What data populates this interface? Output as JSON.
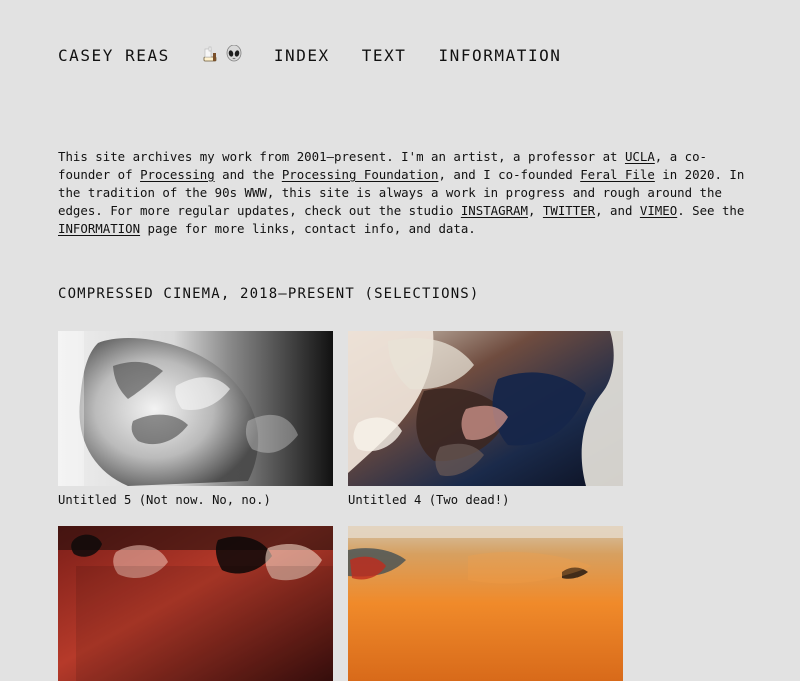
{
  "header": {
    "brand": "CASEY REAS",
    "emoji_icons": [
      "pipe-icon",
      "alien-icon"
    ],
    "nav": [
      "INDEX",
      "TEXT",
      "INFORMATION"
    ]
  },
  "intro": {
    "p1": "This site archives my work from 2001–present. I'm an artist, a professor at ",
    "link_ucla": "UCLA",
    "p2": ", a co-founder of ",
    "link_processing": "Processing",
    "p3": " and the ",
    "link_processing_foundation": "Processing Foundation",
    "p4": ", and I co-founded ",
    "link_feral_file": "Feral File",
    "p5": " in 2020. In the tradition of the 90s WWW, this site is always a work in progress and rough around the edges. For more regular updates, check out the studio ",
    "link_instagram": "INSTAGRAM",
    "p6": ", ",
    "link_twitter": "TWITTER",
    "p7": ", and ",
    "link_vimeo": "VIMEO",
    "p8": ". See the ",
    "link_information": "INFORMATION",
    "p9": " page for more links, contact info, and data."
  },
  "section": {
    "title": "COMPRESSED CINEMA, 2018–PRESENT (SELECTIONS)"
  },
  "works": [
    {
      "caption": "Untitled 5 (Not now. No, no.)"
    },
    {
      "caption": "Untitled 4 (Two dead!)"
    },
    {
      "caption": ""
    },
    {
      "caption": ""
    }
  ],
  "colors": {
    "background": "#e2e2e2",
    "text": "#111111"
  }
}
